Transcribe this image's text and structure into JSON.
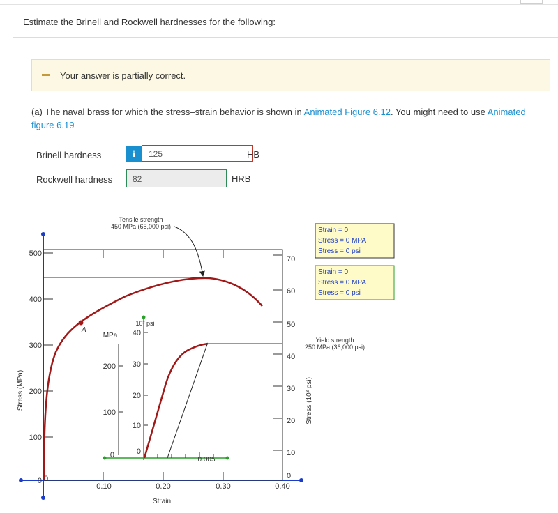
{
  "question": {
    "prompt": "Estimate the Brinell and Rockwell hardnesses for the following:"
  },
  "feedback": {
    "text": "Your answer is partially correct.",
    "color": "#fcf8e3"
  },
  "part_a": {
    "text_before": "(a) The naval brass for which the stress–strain behavior is shown in ",
    "link1": "Animated Figure 6.12",
    "text_middle": ". You might need to use ",
    "link2": "Animated figure 6.19"
  },
  "brinell": {
    "label": "Brinell hardness",
    "info": "i",
    "value": "125",
    "unit": "HB",
    "status_color": "#c0392b"
  },
  "rockwell": {
    "label": "Rockwell hardness",
    "value": "82",
    "unit": "HRB",
    "status_color": "#2e8b57"
  },
  "chart": {
    "ylabel_left": "Stress (MPa)",
    "ylabel_right": "Stress (10³ psi)",
    "xlabel": "Strain",
    "mpa_ticks": [
      "0",
      "100",
      "200",
      "300",
      "400",
      "500"
    ],
    "psi_ticks": [
      "0",
      "10",
      "20",
      "30",
      "40",
      "50",
      "60",
      "70"
    ],
    "strain_ticks": [
      "0",
      "0.10",
      "0.20",
      "0.30",
      "0.40"
    ],
    "ts_annotation": [
      "Tensile strength",
      "450 MPa (65,000 psi)"
    ],
    "ys_annotation": [
      "Yield strength",
      "250 MPa (36,000 psi)"
    ],
    "point_label": "A",
    "inset_mpa_label": "MPa",
    "inset_psi_label": "10³ psi",
    "inset_mpa_ticks": [
      "0",
      "100",
      "200"
    ],
    "inset_psi_ticks": [
      "0",
      "10",
      "20",
      "30",
      "40"
    ],
    "inset_strain_tick": "0.005",
    "readout1": [
      "Strain = 0",
      "Stress = 0 MPA",
      "Stress = 0 psi"
    ],
    "readout2": [
      "Strain = 0",
      "Stress = 0 MPA",
      "Stress = 0 psi"
    ],
    "curve_color": "#a01818",
    "axis_color": "#1a3cc8",
    "inset_axis_color": "#2aa02a",
    "readout_bg": "#fffbc8"
  }
}
